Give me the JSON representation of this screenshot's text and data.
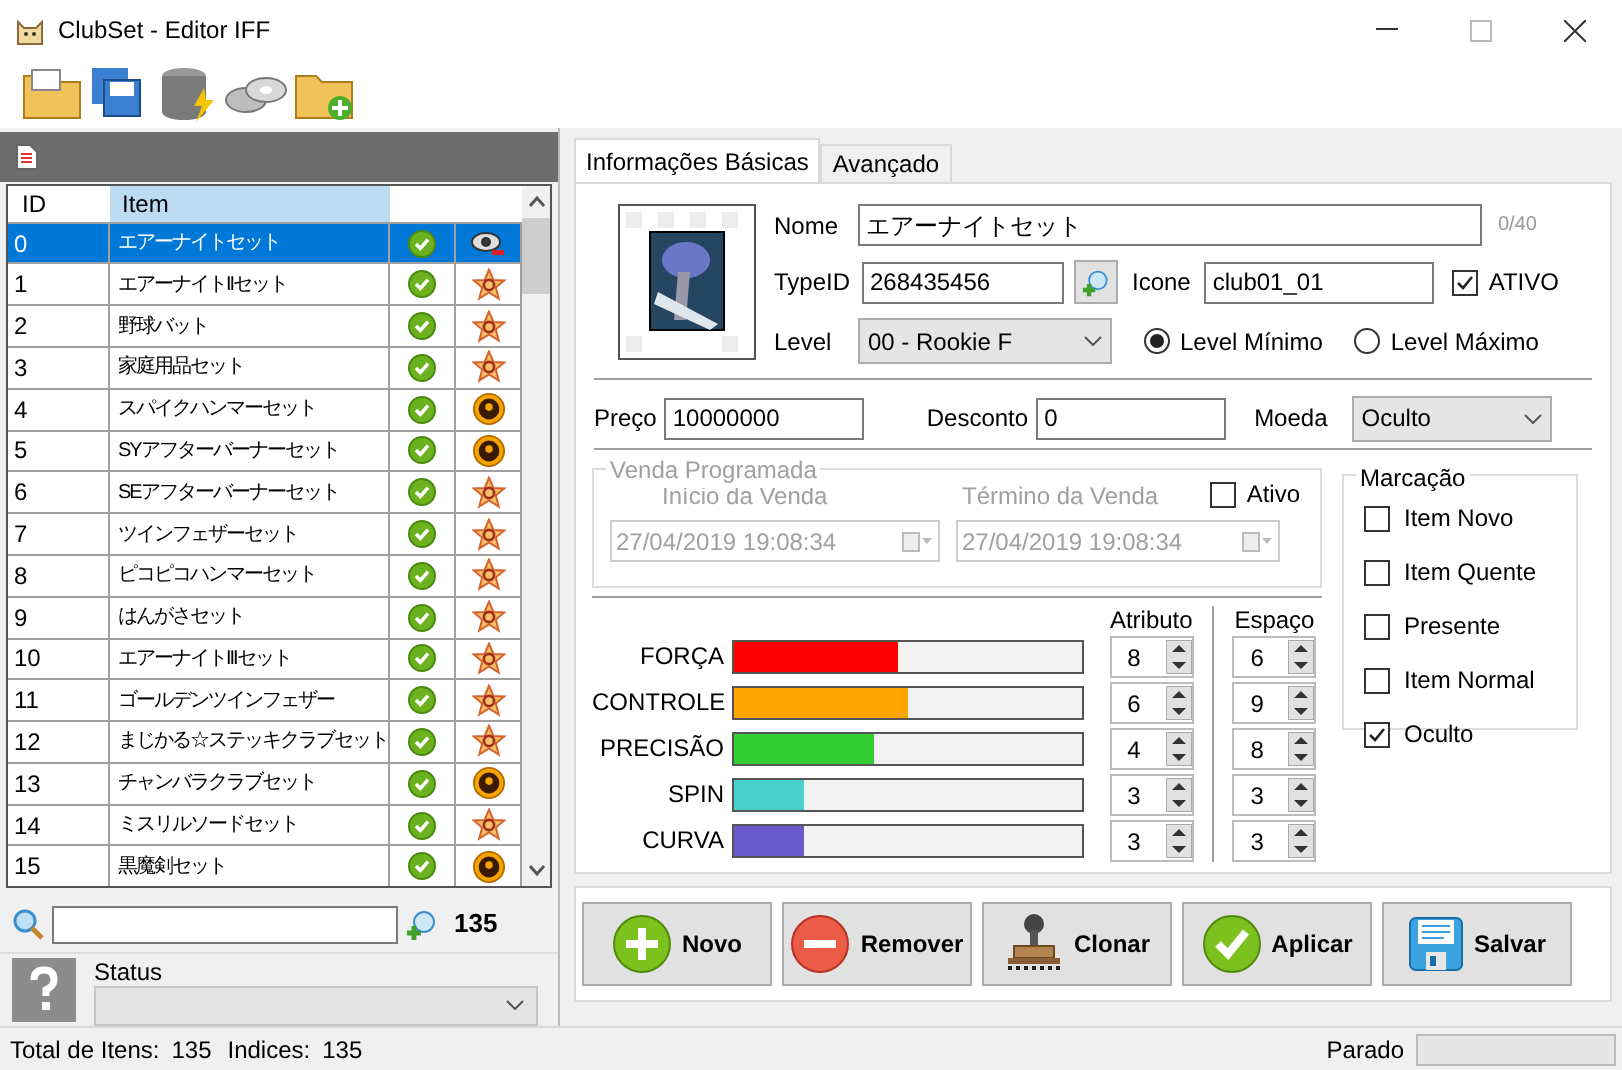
{
  "window": {
    "title": "ClubSet - Editor IFF"
  },
  "list": {
    "columns": [
      "ID",
      "Item"
    ],
    "rows": [
      {
        "id": "0",
        "name": "エアーナイトセット",
        "selected": true,
        "kind": "eye"
      },
      {
        "id": "1",
        "name": "エアーナイトIIセット",
        "selected": false,
        "kind": "star"
      },
      {
        "id": "2",
        "name": "野球バット",
        "selected": false,
        "kind": "star"
      },
      {
        "id": "3",
        "name": "家庭用品セット",
        "selected": false,
        "kind": "star"
      },
      {
        "id": "4",
        "name": "スパイクハンマーセット",
        "selected": false,
        "kind": "coin"
      },
      {
        "id": "5",
        "name": "SYアフターバーナーセット",
        "selected": false,
        "kind": "coin"
      },
      {
        "id": "6",
        "name": "SEアフターバーナーセット",
        "selected": false,
        "kind": "star"
      },
      {
        "id": "7",
        "name": "ツインフェザーセット",
        "selected": false,
        "kind": "star"
      },
      {
        "id": "8",
        "name": "ピコピコハンマーセット",
        "selected": false,
        "kind": "star"
      },
      {
        "id": "9",
        "name": "はんがさセット",
        "selected": false,
        "kind": "star"
      },
      {
        "id": "10",
        "name": "エアーナイトIIIセット",
        "selected": false,
        "kind": "star"
      },
      {
        "id": "11",
        "name": "ゴールデンツインフェザー",
        "selected": false,
        "kind": "star"
      },
      {
        "id": "12",
        "name": "まじかる☆ステッキクラブセット",
        "selected": false,
        "kind": "star"
      },
      {
        "id": "13",
        "name": "チャンバラクラブセット",
        "selected": false,
        "kind": "coin"
      },
      {
        "id": "14",
        "name": "ミスリルソードセット",
        "selected": false,
        "kind": "star"
      },
      {
        "id": "15",
        "name": "黒魔剣セット",
        "selected": false,
        "kind": "coin"
      }
    ]
  },
  "search": {
    "count": "135"
  },
  "status_field": {
    "label": "Status"
  },
  "tabs": [
    {
      "label": "Informações Básicas",
      "selected": true
    },
    {
      "label": "Avançado",
      "selected": false
    }
  ],
  "form": {
    "nome_label": "Nome",
    "nome": "エアーナイトセット",
    "nome_count": "0/40",
    "typeid_label": "TypeID",
    "typeid": "268435456",
    "icone_label": "Icone",
    "icone": "club01_01",
    "ativo": {
      "label": "ATIVO",
      "checked": true
    },
    "level_label": "Level",
    "level": "00 - Rookie F",
    "level_radios": [
      {
        "label": "Level Mínimo",
        "selected": true
      },
      {
        "label": "Level Máximo",
        "selected": false
      }
    ],
    "preco_label": "Preço",
    "preco": "10000000",
    "desconto_label": "Desconto",
    "desconto": "0",
    "moeda_label": "Moeda",
    "moeda": "Oculto"
  },
  "venda": {
    "title": "Venda Programada",
    "disabled": true,
    "ativo": {
      "label": "Ativo",
      "checked": false
    },
    "inicio_label": "Início da Venda",
    "inicio": "27/04/2019 19:08:34",
    "termino_label": "Término da Venda",
    "termino": "27/04/2019 19:08:34"
  },
  "marcacao": {
    "title": "Marcação",
    "items": [
      {
        "label": "Item Novo",
        "checked": false
      },
      {
        "label": "Item Quente",
        "checked": false
      },
      {
        "label": "Presente",
        "checked": false
      },
      {
        "label": "Item Normal",
        "checked": false
      },
      {
        "label": "Oculto",
        "checked": true
      }
    ]
  },
  "stats": {
    "atributo_label": "Atributo",
    "espaco_label": "Espaço",
    "rows": [
      {
        "name": "FORÇA",
        "color": "#ff0000",
        "level": 0.47,
        "atributo": "8",
        "espaco": "6"
      },
      {
        "name": "CONTROLE",
        "color": "#ffa500",
        "level": 0.5,
        "atributo": "6",
        "espaco": "9"
      },
      {
        "name": "PRECISÃO",
        "color": "#32cd32",
        "level": 0.4,
        "atributo": "4",
        "espaco": "8"
      },
      {
        "name": "SPIN",
        "color": "#48d1cc",
        "level": 0.2,
        "atributo": "3",
        "espaco": "3"
      },
      {
        "name": "CURVA",
        "color": "#6a5acd",
        "level": 0.2,
        "atributo": "3",
        "espaco": "3"
      }
    ]
  },
  "actions": [
    {
      "label": "Novo",
      "kind": "add"
    },
    {
      "label": "Remover",
      "kind": "remove"
    },
    {
      "label": "Clonar",
      "kind": "stamp"
    },
    {
      "label": "Aplicar",
      "kind": "apply"
    },
    {
      "label": "Salvar",
      "kind": "save"
    }
  ],
  "status_bar": {
    "total_label": "Total de Itens:",
    "total": "135",
    "indices_label": "Indices:",
    "indices": "135",
    "state": "Parado",
    "level": 0
  }
}
